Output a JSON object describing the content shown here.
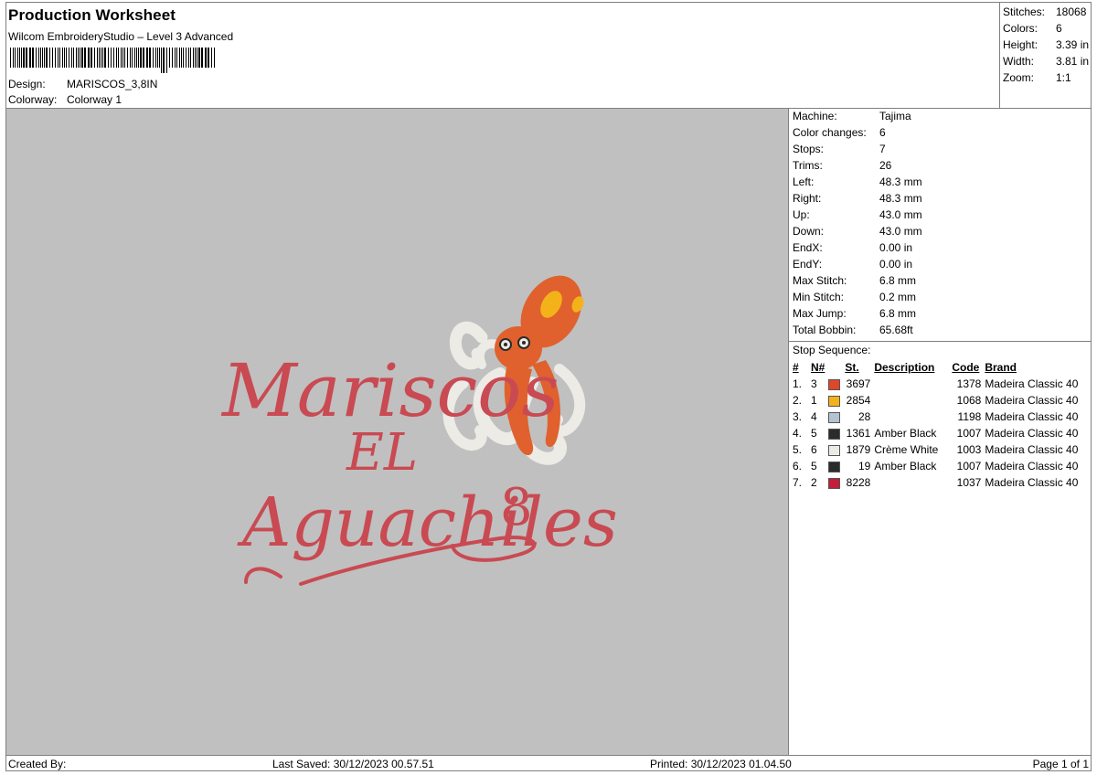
{
  "header": {
    "title": "Production Worksheet",
    "software": "Wilcom EmbroideryStudio – Level 3 Advanced",
    "design_label": "Design:",
    "design_value": "MARISCOS_3,8IN",
    "colorway_label": "Colorway:",
    "colorway_value": "Colorway 1"
  },
  "summary": [
    {
      "label": "Stitches:",
      "value": "18068"
    },
    {
      "label": "Colors:",
      "value": "6"
    },
    {
      "label": "Height:",
      "value": "3.39 in"
    },
    {
      "label": "Width:",
      "value": "3.81 in"
    },
    {
      "label": "Zoom:",
      "value": "1:1"
    }
  ],
  "machine": [
    {
      "label": "Machine:",
      "value": "Tajima"
    },
    {
      "label": "Color changes:",
      "value": "6"
    },
    {
      "label": "Stops:",
      "value": "7"
    },
    {
      "label": "Trims:",
      "value": "26"
    },
    {
      "label": "Left:",
      "value": "48.3 mm"
    },
    {
      "label": "Right:",
      "value": "48.3 mm"
    },
    {
      "label": "Up:",
      "value": "43.0 mm"
    },
    {
      "label": "Down:",
      "value": "43.0 mm"
    },
    {
      "label": "EndX:",
      "value": "0.00 in"
    },
    {
      "label": "EndY:",
      "value": "0.00 in"
    },
    {
      "label": "Max Stitch:",
      "value": "6.8 mm"
    },
    {
      "label": "Min Stitch:",
      "value": "0.2 mm"
    },
    {
      "label": "Max Jump:",
      "value": "6.8 mm"
    },
    {
      "label": "Total Bobbin:",
      "value": "65.68ft"
    }
  ],
  "stop_sequence": {
    "title": "Stop Sequence:",
    "columns": {
      "num": "#",
      "n": "N#",
      "st": "St.",
      "desc": "Description",
      "code": "Code",
      "brand": "Brand"
    },
    "rows": [
      {
        "num": "1.",
        "n": "3",
        "color": "#e0462a",
        "st": "3697",
        "desc": "",
        "code": "1378",
        "brand": "Madeira Classic 40"
      },
      {
        "num": "2.",
        "n": "1",
        "color": "#f4b21a",
        "st": "2854",
        "desc": "",
        "code": "1068",
        "brand": "Madeira Classic 40"
      },
      {
        "num": "3.",
        "n": "4",
        "color": "#b4c2d2",
        "st": "28",
        "desc": "",
        "code": "1198",
        "brand": "Madeira Classic 40"
      },
      {
        "num": "4.",
        "n": "5",
        "color": "#2b2b2b",
        "st": "1361",
        "desc": "Amber Black",
        "code": "1007",
        "brand": "Madeira Classic 40"
      },
      {
        "num": "5.",
        "n": "6",
        "color": "#ecebe6",
        "st": "1879",
        "desc": "Crème White",
        "code": "1003",
        "brand": "Madeira Classic 40"
      },
      {
        "num": "6.",
        "n": "5",
        "color": "#2b2b2b",
        "st": "19",
        "desc": "Amber Black",
        "code": "1007",
        "brand": "Madeira Classic 40"
      },
      {
        "num": "7.",
        "n": "2",
        "color": "#c41e3a",
        "st": "8228",
        "desc": "",
        "code": "1037",
        "brand": "Madeira Classic 40"
      }
    ]
  },
  "preview": {
    "background": "#c0c0c0",
    "text_color": "#c94a52",
    "line1": "Mariscos",
    "line2": "EL",
    "line3": "Aguachiles",
    "line3_suffix": "8",
    "octopus_color": "#e0612d",
    "octopus_highlight": "#f4b21a",
    "tentacle_color": "#ecebe6"
  },
  "footer": {
    "created": "Created By:",
    "saved": "Last Saved: 30/12/2023 00.57.51",
    "printed": "Printed: 30/12/2023 01.04.50",
    "page": "Page 1 of 1"
  }
}
